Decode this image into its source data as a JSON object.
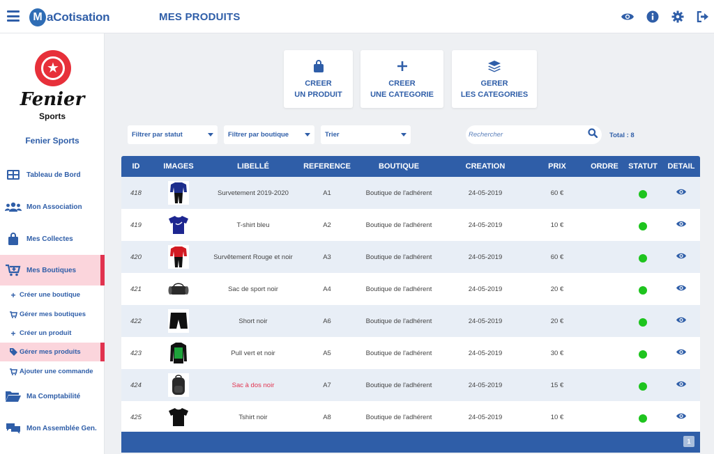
{
  "header": {
    "menu_icon": "hamburger-icon",
    "logo_mark": "M",
    "logo_text": "aCotisation",
    "page_title": "MES PRODUITS",
    "icons": [
      "eye-icon",
      "info-icon",
      "gear-icon",
      "logout-icon"
    ]
  },
  "sidebar": {
    "brand_logo_word": "Fenier",
    "brand_logo_sub": "Sports",
    "brand_name": "Fenier Sports",
    "items": [
      {
        "label": "Tableau de Bord",
        "icon": "dashboard-icon"
      },
      {
        "label": "Mon Association",
        "icon": "users-icon"
      },
      {
        "label": "Mes Collectes",
        "icon": "bag-icon"
      },
      {
        "label": "Mes Boutiques",
        "icon": "cart-plus-icon"
      },
      {
        "label": "Ma Comptabilité",
        "icon": "folder-icon"
      },
      {
        "label": "Mon Assemblée Gen.",
        "icon": "chat-icon"
      }
    ],
    "subitems": [
      {
        "label": "Créer une boutique",
        "icon": "plus-icon"
      },
      {
        "label": "Gérer mes boutiques",
        "icon": "cart-icon"
      },
      {
        "label": "Créer un produit",
        "icon": "plus-icon"
      },
      {
        "label": "Gérer mes produits",
        "icon": "tag-icon"
      },
      {
        "label": "Ajouter une commande",
        "icon": "cart-icon"
      }
    ]
  },
  "actions": {
    "create_product": {
      "line1": "CREER",
      "line2": "UN PRODUIT",
      "icon": "shopping-bag-icon"
    },
    "create_category": {
      "line1": "CREER",
      "line2": "UNE CATEGORIE",
      "icon": "plus-icon"
    },
    "manage_categories": {
      "line1": "GERER",
      "line2": "LES CATEGORIES",
      "icon": "layers-icon"
    }
  },
  "filters": {
    "status": "Filtrer par statut",
    "shop": "Filtrer par boutique",
    "sort": "Trier",
    "search_placeholder": "Rechercher",
    "total": "Total : 8"
  },
  "table": {
    "columns": [
      "ID",
      "IMAGES",
      "LIBELLÉ",
      "REFERENCE",
      "BOUTIQUE",
      "CREATION",
      "PRIX",
      "ORDRE",
      "STATUT",
      "DETAIL"
    ],
    "rows": [
      {
        "id": "418",
        "image": "tracksuit-blue",
        "label": "Survetement 2019-2020",
        "ref": "A1",
        "shop": "Boutique de l'adhérent",
        "created": "24-05-2019",
        "price": "60 €",
        "order": "",
        "status": "active"
      },
      {
        "id": "419",
        "image": "tshirt-blue",
        "label": "T-shirt bleu",
        "ref": "A2",
        "shop": "Boutique de l'adhérent",
        "created": "24-05-2019",
        "price": "10 €",
        "order": "",
        "status": "active"
      },
      {
        "id": "420",
        "image": "tracksuit-red",
        "label": "Survêtement Rouge et noir",
        "ref": "A3",
        "shop": "Boutique de l'adhérent",
        "created": "24-05-2019",
        "price": "60 €",
        "order": "",
        "status": "active"
      },
      {
        "id": "421",
        "image": "sport-bag",
        "label": "Sac de sport noir",
        "ref": "A4",
        "shop": "Boutique de l'adhérent",
        "created": "24-05-2019",
        "price": "20 €",
        "order": "",
        "status": "active"
      },
      {
        "id": "422",
        "image": "short-black",
        "label": "Short noir",
        "ref": "A6",
        "shop": "Boutique de l'adhérent",
        "created": "24-05-2019",
        "price": "20 €",
        "order": "",
        "status": "active"
      },
      {
        "id": "423",
        "image": "pullover-green",
        "label": "Pull vert et noir",
        "ref": "A5",
        "shop": "Boutique de l'adhérent",
        "created": "24-05-2019",
        "price": "30 €",
        "order": "",
        "status": "active"
      },
      {
        "id": "424",
        "image": "backpack-black",
        "label": "Sac à dos noir",
        "ref": "A7",
        "shop": "Boutique de l'adhérent",
        "created": "24-05-2019",
        "price": "15 €",
        "order": "",
        "status": "active"
      },
      {
        "id": "425",
        "image": "tshirt-black",
        "label": "Tshirt noir",
        "ref": "A8",
        "shop": "Boutique de l'adhérent",
        "created": "24-05-2019",
        "price": "10 €",
        "order": "",
        "status": "active"
      }
    ]
  },
  "pagination": {
    "current": "1"
  },
  "colors": {
    "primary": "#2f5ea8",
    "accent": "#e1334f",
    "active_bg": "#fbd5dc",
    "status_green": "#1ec41e",
    "row_alt": "#e8eef6"
  }
}
